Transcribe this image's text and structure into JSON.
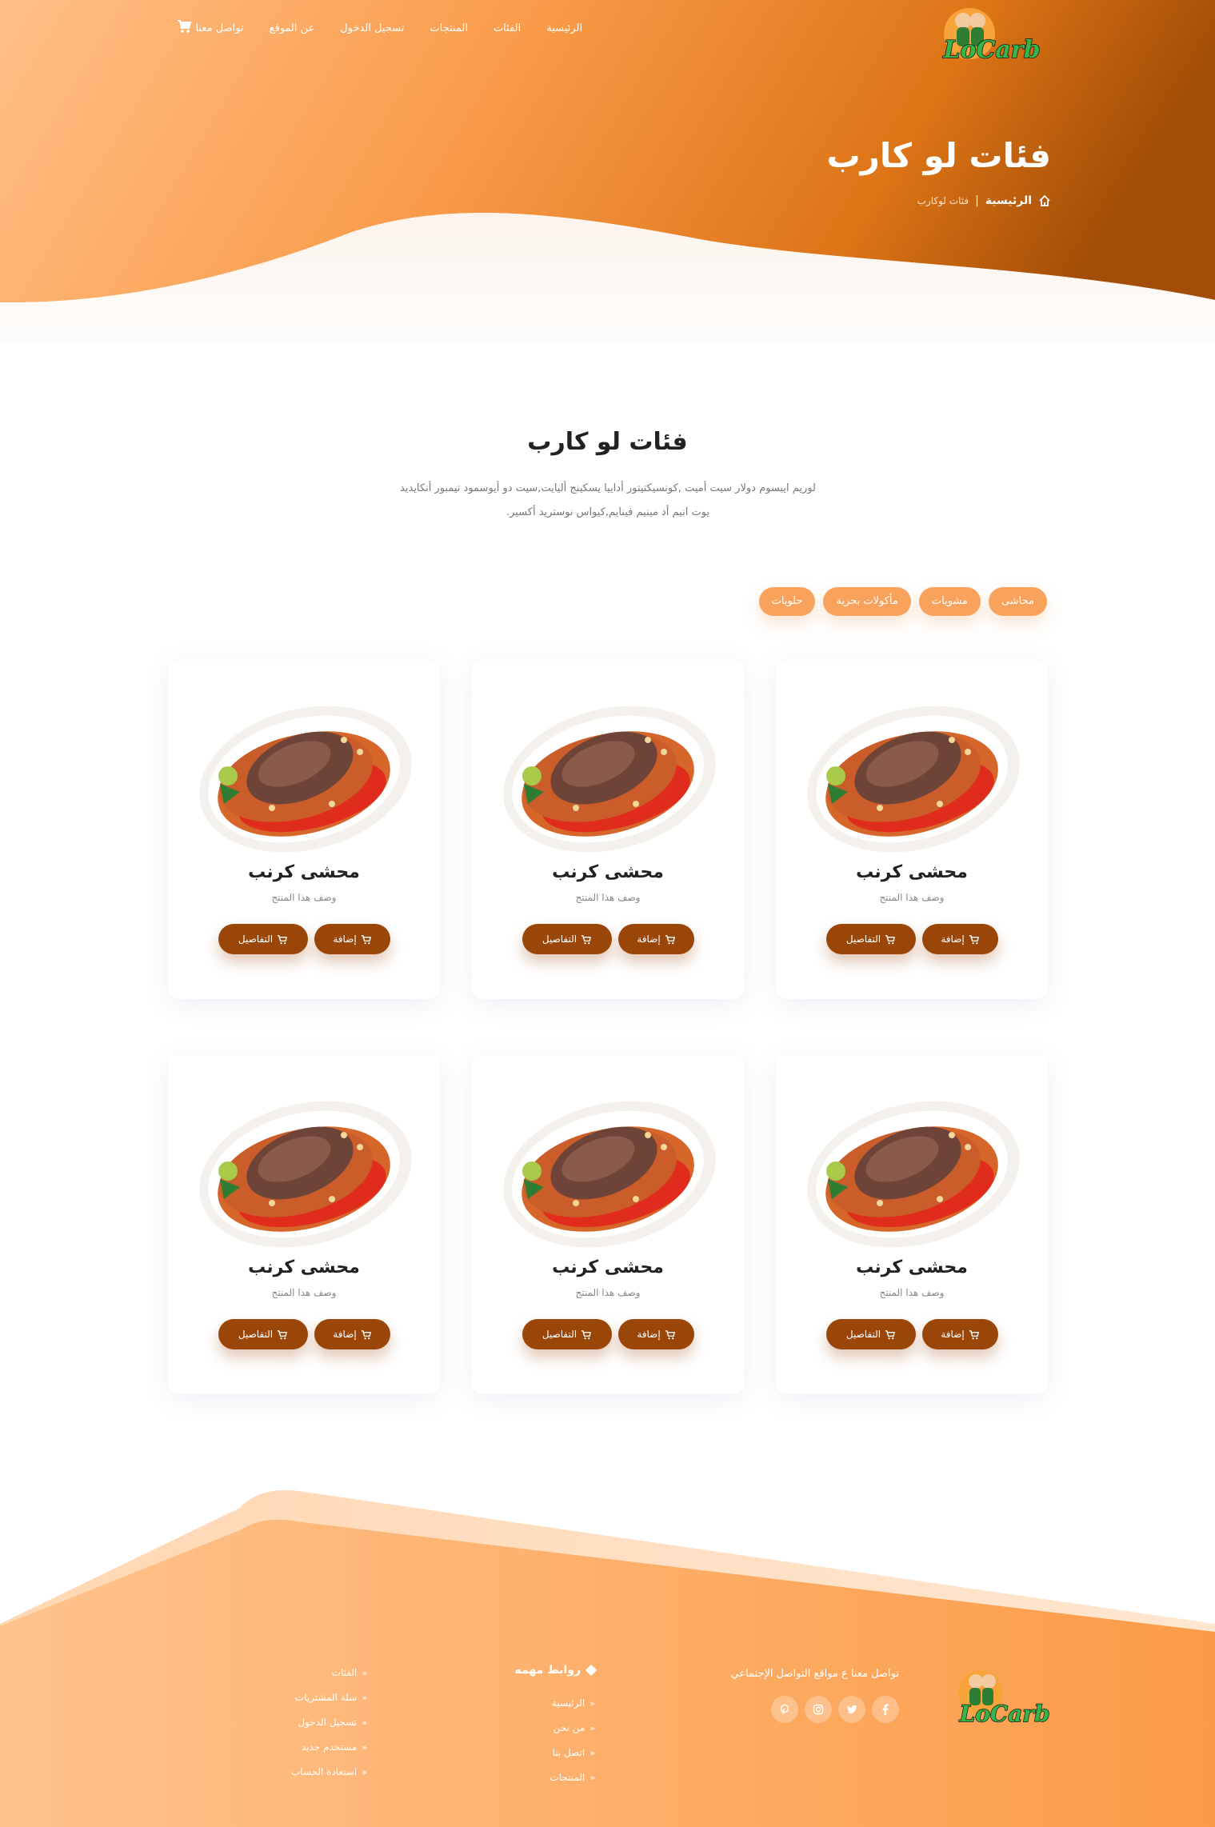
{
  "brand": {
    "logo_text": "LoCarb"
  },
  "nav": {
    "items": [
      "الرئيسية",
      "الفئات",
      "المنتجات",
      "تسجيل الدخول",
      "عن الموقع",
      "تواصل معنا"
    ],
    "cart_icon": "cart-icon"
  },
  "hero": {
    "title": "فئات لو كارب",
    "breadcrumb_home": "الرئيسية",
    "breadcrumb_separator": "|",
    "breadcrumb_current": "فئات لوكارب"
  },
  "section": {
    "title": "فئات لو كارب",
    "description_line1": "لوريم ايبسوم دولار سيت أميت ,كونسيكتيتور أداييا يسكينج أليايت,سيت دو أيوسمود تيمبور أنكايديد",
    "description_line2": "يوت انيم أد مينيم فينايم,كيواس نوستريد أكسير."
  },
  "filters": [
    "محاشى",
    "مشويات",
    "مأكولات بحرية",
    "حلويات"
  ],
  "products": [
    {
      "name": "محشى كرنب",
      "description": "وصف هذا المنتج",
      "add_label": "إضافة",
      "details_label": "التفاصيل"
    },
    {
      "name": "محشى كرنب",
      "description": "وصف هذا المنتج",
      "add_label": "إضافة",
      "details_label": "التفاصيل"
    },
    {
      "name": "محشى كرنب",
      "description": "وصف هذا المنتج",
      "add_label": "إضافة",
      "details_label": "التفاصيل"
    },
    {
      "name": "محشى كرنب",
      "description": "وصف هذا المنتج",
      "add_label": "إضافة",
      "details_label": "التفاصيل"
    },
    {
      "name": "محشى كرنب",
      "description": "وصف هذا المنتج",
      "add_label": "إضافة",
      "details_label": "التفاصيل"
    },
    {
      "name": "محشى كرنب",
      "description": "وصف هذا المنتج",
      "add_label": "إضافة",
      "details_label": "التفاصيل"
    }
  ],
  "footer": {
    "social_text": "تواصل معنا ع مواقع التواصل الإجتماعي",
    "social_icons": [
      "facebook-icon",
      "twitter-icon",
      "instagram-icon",
      "pinterest-icon"
    ],
    "links_heading": "روابط مهمه",
    "links_col1": [
      "الرئيسية",
      "من نحن",
      "اتصل بنا",
      "المنتجات"
    ],
    "links_col2": [
      "الفئات",
      "سلة المشتريات",
      "تسجيل الدخول",
      "مستخدم جديد",
      "استعادة الحساب"
    ]
  },
  "colors": {
    "accent_orange": "#f8a25c",
    "hero_dark": "#a34e06",
    "button_brown": "#9a4609",
    "footer_light": "#ffc08a",
    "footer_orange": "#fb9a47"
  }
}
